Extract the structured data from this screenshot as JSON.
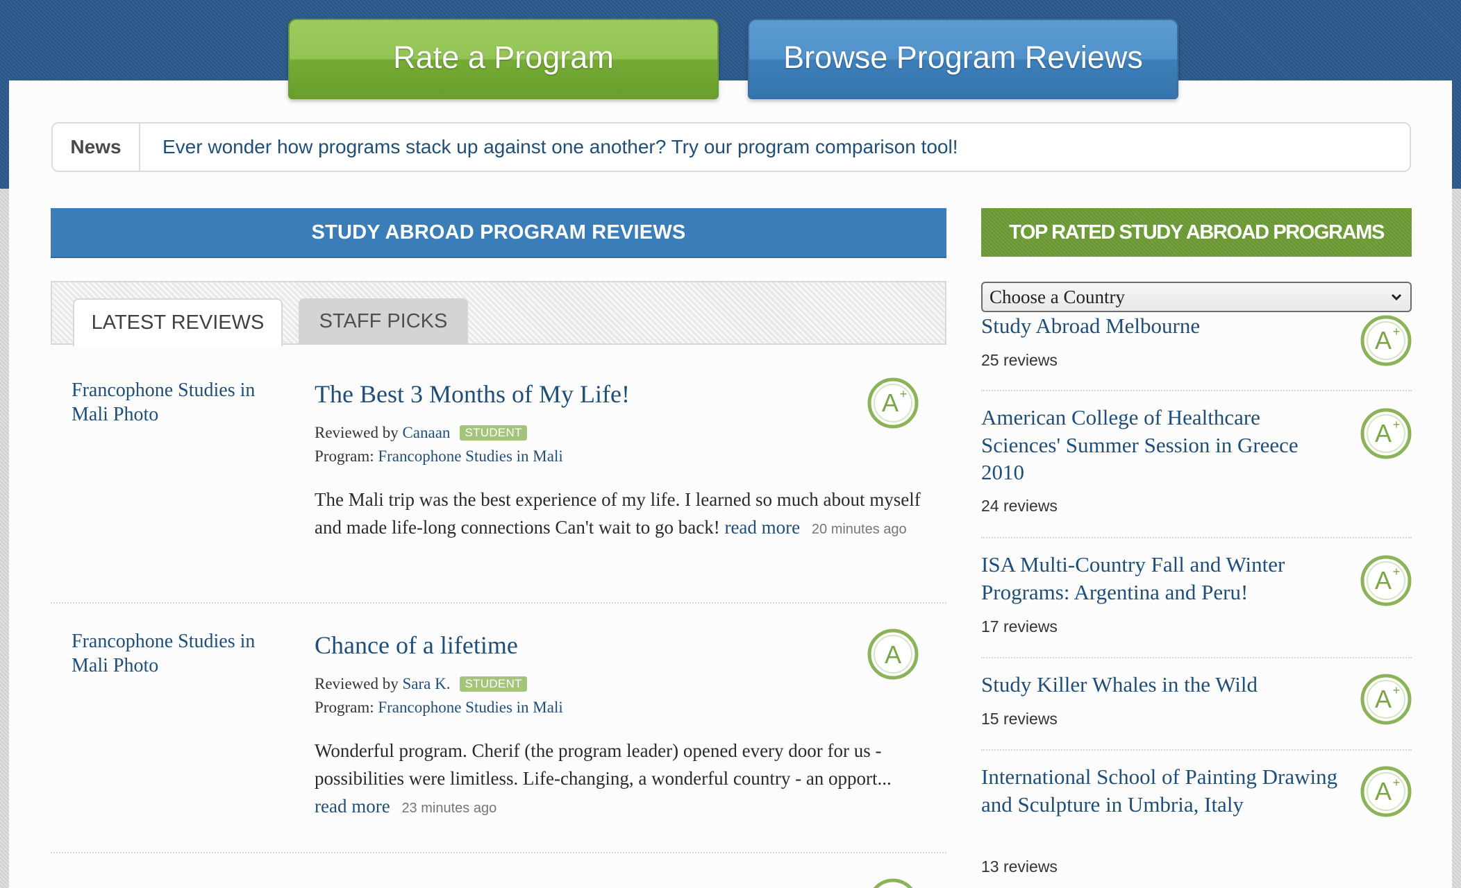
{
  "actions": {
    "rate_label": "Rate a Program",
    "browse_label": "Browse Program Reviews"
  },
  "news": {
    "label": "News",
    "text": "Ever wonder how programs stack up against one another? Try our program comparison tool!"
  },
  "reviews_section": {
    "title": "STUDY ABROAD PROGRAM REVIEWS",
    "tabs": [
      {
        "label": "LATEST REVIEWS",
        "active": true
      },
      {
        "label": "STAFF PICKS",
        "active": false
      }
    ],
    "items": [
      {
        "photo_alt": "Francophone Studies in Mali Photo",
        "title": "The Best 3 Months of My Life!",
        "reviewed_by_label": "Reviewed by",
        "reviewer": "Canaan",
        "badge": "STUDENT",
        "program_label": "Program:",
        "program": "Francophone Studies in Mali",
        "body": "The Mali trip was the best experience of my life. I learned so much about myself and made life-long connections Can't wait to go back!",
        "read_more": "read more",
        "time": "20 minutes ago",
        "grade": "A+"
      },
      {
        "photo_alt": "Francophone Studies in Mali Photo",
        "title": "Chance of a lifetime",
        "reviewed_by_label": "Reviewed by",
        "reviewer": "Sara K.",
        "badge": "STUDENT",
        "program_label": "Program:",
        "program": "Francophone Studies in Mali",
        "body": "Wonderful program. Cherif (the program leader) opened every door for us - possibilities were limitless. Life-changing, a wonderful country - an opport...",
        "read_more": "read more",
        "time": "23 minutes ago",
        "grade": "A"
      }
    ]
  },
  "top_rated": {
    "title": "TOP RATED STUDY ABROAD PROGRAMS",
    "country_select": "Choose a Country",
    "items": [
      {
        "name": "Study Abroad Melbourne",
        "reviews": "25 reviews",
        "grade": "A+"
      },
      {
        "name": "American College of Healthcare Sciences' Summer Session in Greece 2010",
        "reviews": "24 reviews",
        "grade": "A+"
      },
      {
        "name": "ISA Multi-Country Fall and Winter Programs: Argentina and Peru!",
        "reviews": "17 reviews",
        "grade": "A+"
      },
      {
        "name": "Study Killer Whales in the Wild",
        "reviews": "15 reviews",
        "grade": "A+"
      },
      {
        "name": "International School of Painting Drawing and Sculpture in Umbria, Italy",
        "reviews": "13 reviews",
        "grade": "A+"
      }
    ]
  },
  "colors": {
    "brand_blue": "#3a7db8",
    "brand_green": "#6d9c35",
    "link": "#1f4e79",
    "badge_green": "#a3c47a"
  }
}
